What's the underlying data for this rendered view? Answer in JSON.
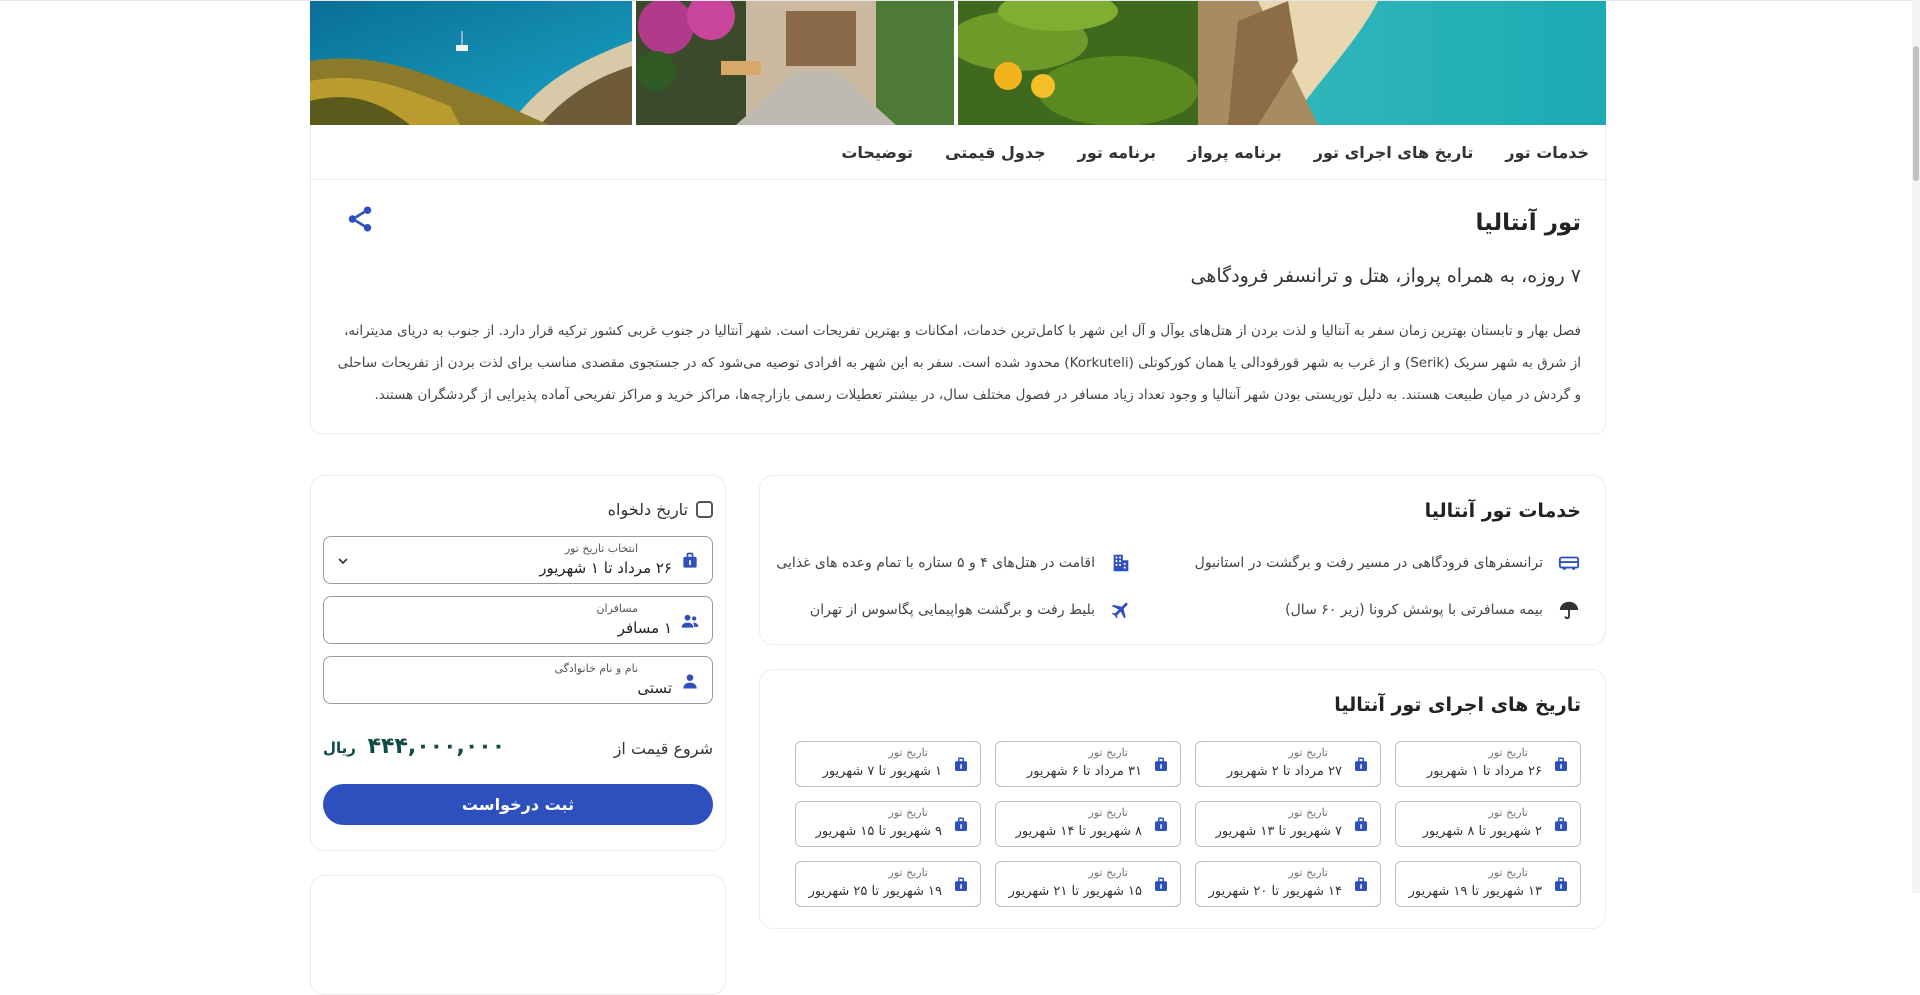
{
  "tabs": [
    "خدمات تور",
    "تاریخ های اجرای تور",
    "برنامه پرواز",
    "برنامه تور",
    "جدول قیمتی",
    "توضیحات"
  ],
  "tour": {
    "title": "تور آنتالیا",
    "subtitle": "۷ روزه، به همراه پرواز، هتل و ترانسفر فرودگاهی",
    "description": "فصل بهار و تابستان بهترین زمان سفر به آنتالیا و لذت بردن از هتل‌های یوآل و آل این شهر با کامل‌ترین خدمات، امکانات و بهترین تفریحات است. شهر آنتالیا در جنوب غربی کشور ترکیه قرار دارد. از جنوب به دریای مدیترانه، از شرق به شهر سریک (Serik) و از غرب به شهر قورقودالی یا همان کورکوتلی (Korkuteli) محدود شده است. سفر به این شهر به افرادی توصیه می‌شود که در جستجوی مقصدی مناسب برای لذت بردن از تفریحات ساحلی و گردش در میان طبیعت هستند. به دلیل توریستی بودن شهر آنتالیا و وجود تعداد زیاد مسافر در فصول مختلف سال، در بیشتر تعطیلات رسمی بازارچه‌ها، مراکز خرید و مراکز تفریحی آماده پذیرایی از گردشگران هستند."
  },
  "services": {
    "title": "خدمات تور آنتالیا",
    "items": [
      {
        "icon": "bus-icon",
        "text": "ترانسفرهای فرودگاهی در مسیر رفت و برگشت در استانبول"
      },
      {
        "icon": "building-icon",
        "text": "اقامت در هتل‌های ۴ و ۵ ستاره با تمام وعده های غذایی"
      },
      {
        "icon": "umbrella-icon",
        "text": "بیمه مسافرتی با پوشش کرونا (زیر ۶۰ سال)"
      },
      {
        "icon": "airplane-icon",
        "text": "بلیط رفت و برگشت هواپیمایی پگاسوس از تهران"
      }
    ]
  },
  "dates": {
    "title": "تاریخ های اجرای تور آنتالیا",
    "chip_label": "تاریخ تور",
    "items": [
      "۲۶ مرداد تا ۱ شهریور",
      "۲۷ مرداد تا ۲ شهریور",
      "۳۱ مرداد تا ۶ شهریور",
      "۱ شهریور تا ۷ شهریور",
      "۲ شهریور تا ۸ شهریور",
      "۷ شهریور تا ۱۳ شهریور",
      "۸ شهریور تا ۱۴ شهریور",
      "۹ شهریور تا ۱۵ شهریور",
      "۱۳ شهریور تا ۱۹ شهریور",
      "۱۴ شهریور تا ۲۰ شهریور",
      "۱۵ شهریور تا ۲۱ شهریور",
      "۱۹ شهریور تا ۲۵ شهریور"
    ]
  },
  "booking": {
    "custom_date_label": "تاریخ دلخواه",
    "date_select_label": "انتخاب تاریخ تور",
    "date_select_value": "۲۶ مرداد تا ۱ شهریور",
    "passengers_label": "مسافران",
    "passengers_value": "۱ مسافر",
    "name_label": "نام و نام خانوادگی",
    "name_value": "تستی",
    "price_label": "شروع قیمت از",
    "price_value": "۴۴۴,۰۰۰,۰۰۰",
    "price_unit": "ریال",
    "submit_label": "ثبت درخواست"
  },
  "colors": {
    "accent": "#2e4fbe",
    "price": "#0f4c47"
  }
}
